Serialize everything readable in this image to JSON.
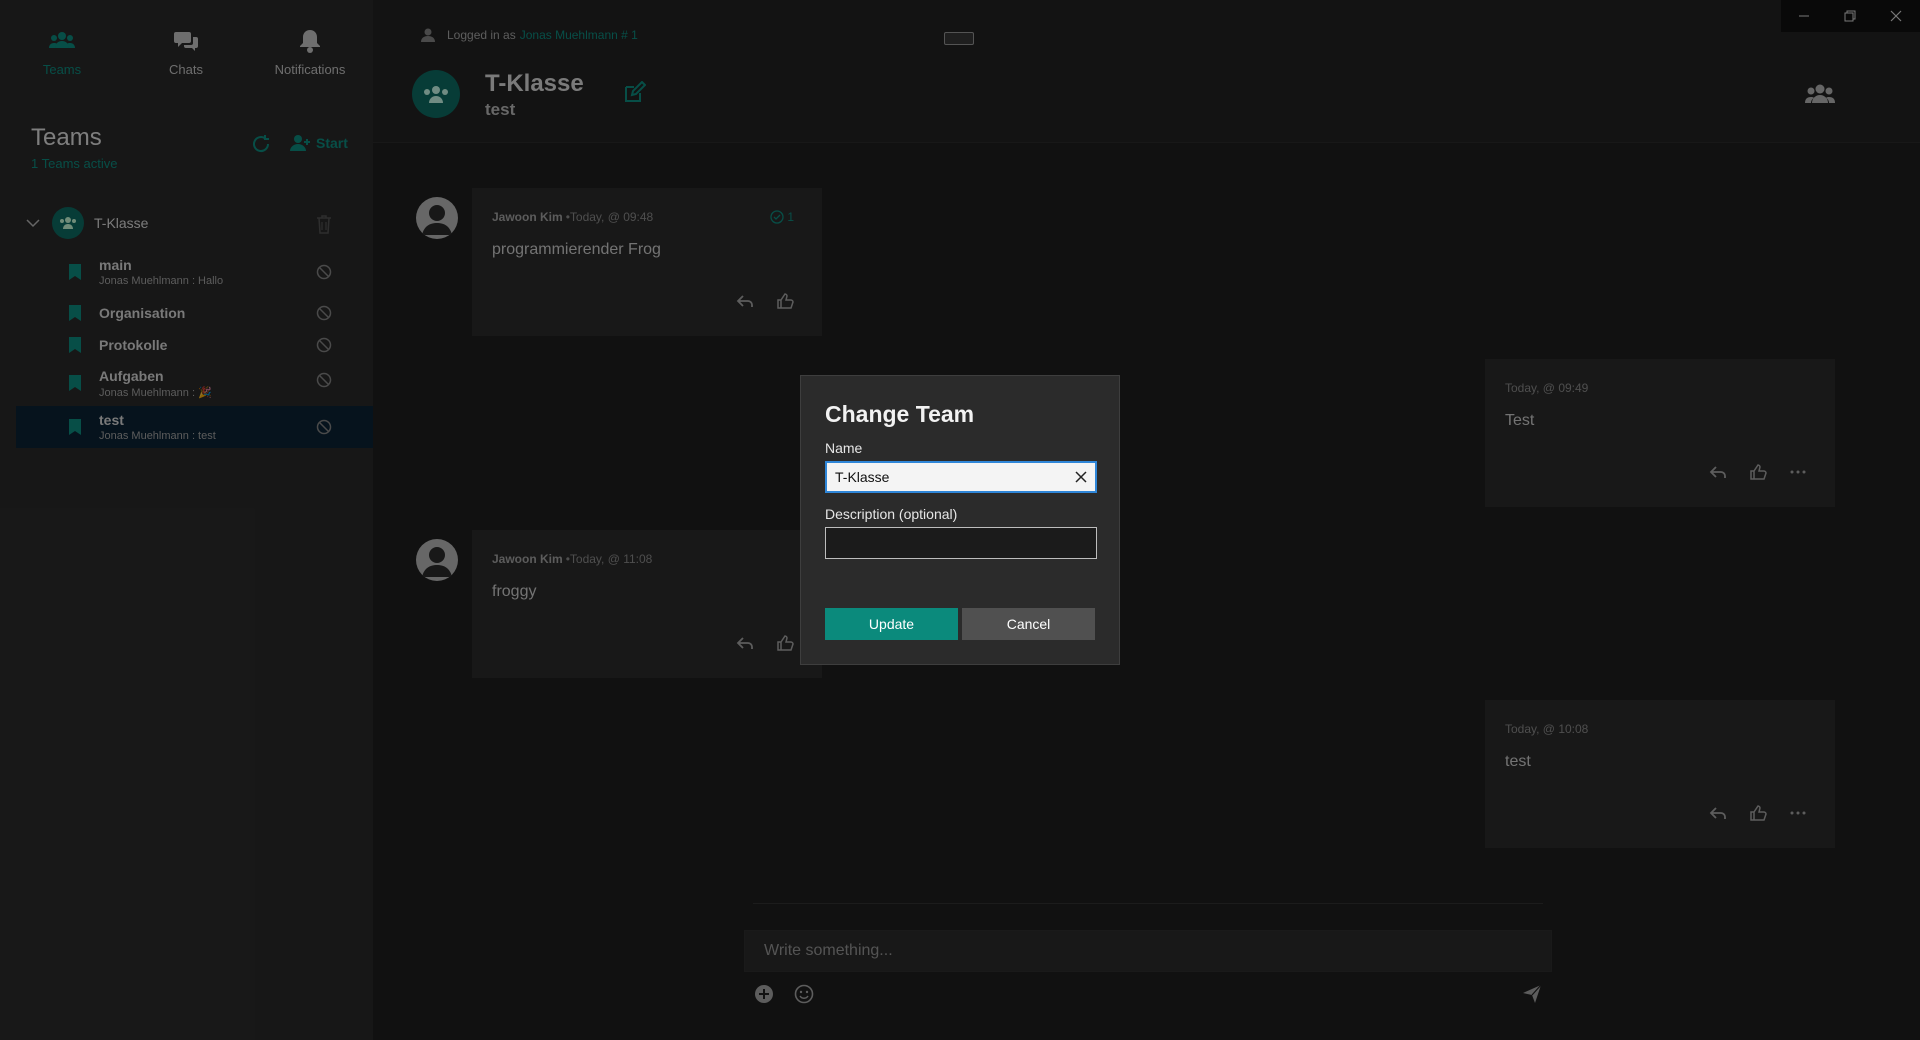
{
  "nav": {
    "teams_label": "Teams",
    "chats_label": "Chats",
    "notifications_label": "Notifications"
  },
  "sidebar": {
    "title": "Teams",
    "subtitle": "1 Teams active",
    "start_label": "Start",
    "team": {
      "name": "T-Klasse"
    },
    "channels": [
      {
        "name": "main",
        "last": "Jonas Muehlmann : Hallo"
      },
      {
        "name": "Organisation",
        "last": ""
      },
      {
        "name": "Protokolle",
        "last": ""
      },
      {
        "name": "Aufgaben",
        "last": "Jonas Muehlmann : 🎉"
      },
      {
        "name": "test",
        "last": "Jonas Muehlmann : test"
      }
    ]
  },
  "header": {
    "logged_in_prefix": "Logged in as",
    "logged_in_user": "Jonas Muehlmann # 1",
    "title": "T-Klasse",
    "subtitle": "test"
  },
  "messages": [
    {
      "author": "Jawoon Kim",
      "time": "•Today, @ 09:48",
      "text": "programmierender Frog",
      "seen_count": "1"
    },
    {
      "author": "",
      "time": "Today, @ 09:49",
      "text": "Test"
    },
    {
      "author": "Jawoon Kim",
      "time": "•Today, @ 11:08",
      "text": "froggy"
    },
    {
      "author": "",
      "time": "Today, @ 10:08",
      "text": "test"
    }
  ],
  "composer": {
    "placeholder": "Write something..."
  },
  "dialog": {
    "title": "Change Team",
    "name_label": "Name",
    "name_value": "T-Klasse",
    "description_label": "Description (optional)",
    "description_value": "",
    "update_label": "Update",
    "cancel_label": "Cancel"
  },
  "colors": {
    "accent": "#0e8f82",
    "background": "#1f1f1f",
    "sidebar": "#2b2b2b",
    "selected_channel": "#0b2436",
    "focus_border": "#2f86d8"
  }
}
